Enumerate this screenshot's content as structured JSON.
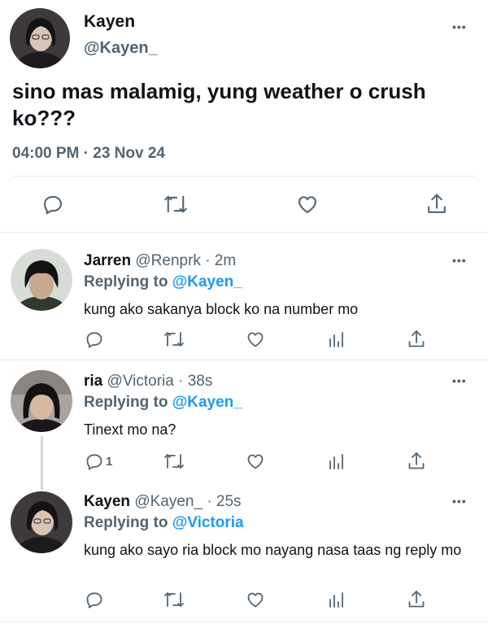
{
  "main_tweet": {
    "name": "Kayen",
    "handle": "@Kayen_",
    "text": "sino mas malamig, yung weather o crush ko???",
    "timestamp": "04:00 PM · 23 Nov 24"
  },
  "replies": [
    {
      "name": "Jarren",
      "meta": "@Renprk · 2m",
      "replying_prefix": "Replying to",
      "replying_to": "@Kayen_",
      "text": "kung ako sakanya block ko na number mo",
      "reply_count": ""
    },
    {
      "name": "ria",
      "meta": "@Victoria · 38s",
      "replying_prefix": "Replying to",
      "replying_to": "@Kayen_",
      "text": "Tinext mo na?",
      "reply_count": "1"
    },
    {
      "name": "Kayen",
      "meta": "@Kayen_ · 25s",
      "replying_prefix": "Replying to",
      "replying_to": "@Victoria",
      "text": "kung ako sayo ria block mo nayang nasa taas ng reply mo",
      "reply_count": ""
    }
  ],
  "more_label": "•••",
  "colors": {
    "link": "#1d9bf0",
    "muted": "#536471",
    "text": "#0f1419",
    "divider": "#e6ecf0"
  },
  "icons": [
    "reply-icon",
    "retweet-icon",
    "like-icon",
    "analytics-icon",
    "share-icon"
  ]
}
